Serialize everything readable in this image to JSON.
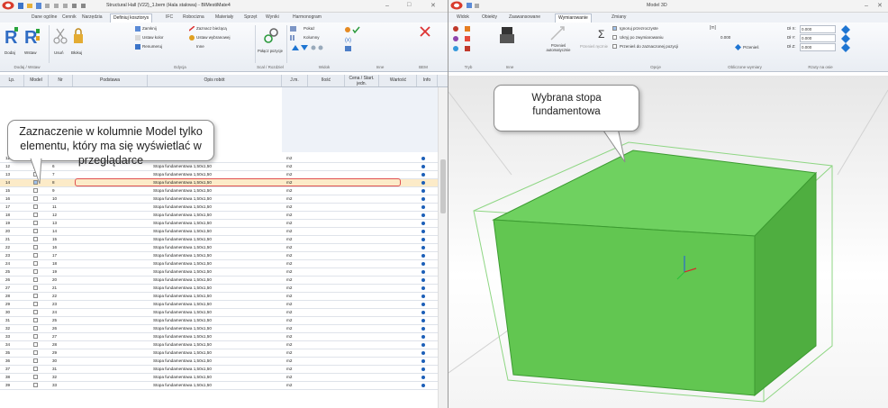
{
  "left_window": {
    "title": "Structural Hall (V22)_1.bem (Hala stalowa) - BIMestiMate4",
    "tabs": [
      "Dane ogólne",
      "Cennik",
      "Narzędzia",
      "Definiuj kosztorys",
      "IFC",
      "Robocizna",
      "Materiały",
      "Sprzęt",
      "Wyniki",
      "Harmonogram"
    ],
    "active_tab": 3,
    "ribbon": {
      "add_label": "Dodaj",
      "insert_label": "Wstaw",
      "delete_label": "Usuń",
      "clip_label": "Błokuj",
      "close_label": "Zamknij",
      "set_color_label": "Ustaw kolor",
      "renumber_label": "Renumeruj",
      "mark_current_label": "Zaznacz bieżącą",
      "set_selected_label": "Ustaw wybranowej",
      "other_label": "Inne",
      "merge_label": "Połącz pozycje",
      "show_label": "Pokaż",
      "columns_label": "Kolumny",
      "groups": [
        "Dodaj / Wstaw",
        "Edycja",
        "Scal / Rozdziel",
        "Widok",
        "Inne",
        "BEM"
      ]
    },
    "grid": {
      "headers": [
        "Lp.",
        "Model",
        "Nr",
        "Podstawa",
        "Opis robót",
        "J.m.",
        "Ilość",
        "Cena / Start. jedn.",
        "Wartość",
        "Info"
      ],
      "row_desc": "Stopa fundamentowa 1,50x1,50",
      "row_unit": "m2",
      "rows": [
        {
          "lp": "11",
          "nr": "5"
        },
        {
          "lp": "12",
          "nr": "6"
        },
        {
          "lp": "13",
          "nr": "7"
        },
        {
          "lp": "14",
          "nr": "8"
        },
        {
          "lp": "15",
          "nr": "9"
        },
        {
          "lp": "16",
          "nr": "10"
        },
        {
          "lp": "17",
          "nr": "11"
        },
        {
          "lp": "18",
          "nr": "12"
        },
        {
          "lp": "19",
          "nr": "13"
        },
        {
          "lp": "20",
          "nr": "14"
        },
        {
          "lp": "21",
          "nr": "15"
        },
        {
          "lp": "22",
          "nr": "16"
        },
        {
          "lp": "23",
          "nr": "17"
        },
        {
          "lp": "24",
          "nr": "18"
        },
        {
          "lp": "25",
          "nr": "19"
        },
        {
          "lp": "26",
          "nr": "20"
        },
        {
          "lp": "27",
          "nr": "21"
        },
        {
          "lp": "28",
          "nr": "22"
        },
        {
          "lp": "29",
          "nr": "23"
        },
        {
          "lp": "30",
          "nr": "24"
        },
        {
          "lp": "31",
          "nr": "25"
        },
        {
          "lp": "32",
          "nr": "26"
        },
        {
          "lp": "33",
          "nr": "27"
        },
        {
          "lp": "34",
          "nr": "28"
        },
        {
          "lp": "35",
          "nr": "29"
        },
        {
          "lp": "36",
          "nr": "30"
        },
        {
          "lp": "37",
          "nr": "31"
        },
        {
          "lp": "38",
          "nr": "32"
        },
        {
          "lp": "39",
          "nr": "33"
        }
      ],
      "selected_row_lp": "14"
    },
    "callout_text": "Zaznaczenie w kolumnie Model tylko elementu, który ma się wyświetlać w przeglądarce"
  },
  "right_window": {
    "title": "Model 3D",
    "tabs": [
      "Widok",
      "Obiekty",
      "Zaawansowane",
      "Wymiarowanie",
      "Zmiany"
    ],
    "active_tab": 3,
    "ribbon": {
      "auto_move_label": "Przenieś automatycznie",
      "manual_label": "Przenieś ręcznie",
      "ignore_hidden_label": "Ignoruj przezroczyste",
      "hide_while_label": "Ukryj po zwymiarowaniu",
      "move_to_selected_label": "Przenieś do zaznaczonej pozycji",
      "move_label": "Przenieś",
      "dim_value": "0.000",
      "dx_label": "Dł X:",
      "dy_label": "Dł Y:",
      "dz_label": "Dł Z:",
      "dx_value": "0.000",
      "dy_value": "0.000",
      "dz_value": "0.000",
      "groups": [
        "Tryb",
        "Inne",
        "Opcje",
        "Obliczone wymiary",
        "Rzuty na osie"
      ]
    },
    "callout_text": "Wybrana stopa fundamentowa",
    "box_color": "#5fc94f"
  }
}
